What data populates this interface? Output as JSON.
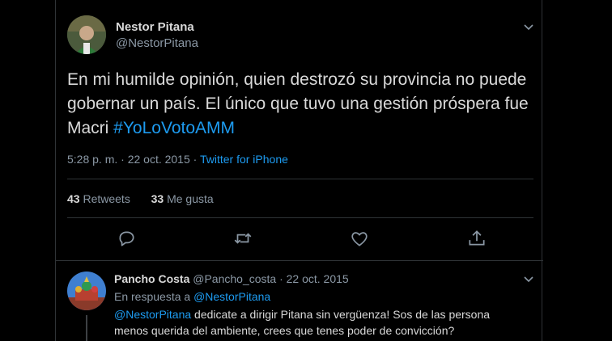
{
  "tweet": {
    "author_name": "Nestor Pitana",
    "author_handle": "@NestorPitana",
    "text_main": "En mi humilde opinión, quien destrozó su provincia no puede gobernar un país. El único que tuvo una gestión próspera fue Macri ",
    "hashtag": "#YoLoVotoAMM",
    "timestamp": "5:28 p. m. · 22 oct. 2015 · ",
    "source": "Twitter for iPhone",
    "retweets_count": "43",
    "retweets_label": " Retweets",
    "likes_count": "33",
    "likes_label": " Me gusta"
  },
  "actions": {
    "reply_icon": "reply-icon",
    "retweet_icon": "retweet-icon",
    "like_icon": "heart-icon",
    "share_icon": "share-icon"
  },
  "reply": {
    "author_name": "Pancho Costa",
    "author_meta": " @Pancho_costa · 22 oct. 2015",
    "in_reply_prefix": "En respuesta a ",
    "in_reply_handle": "@NestorPitana",
    "mention": "@NestorPitana",
    "text": " dedicate a dirigir Pitana sin vergüenza! Sos de las persona menos querida del ambiente, crees que tenes poder de convicción?"
  },
  "colors": {
    "background": "#000000",
    "link": "#1d9bf0",
    "secondary_text": "#8b98a5",
    "border": "#2f3336"
  }
}
